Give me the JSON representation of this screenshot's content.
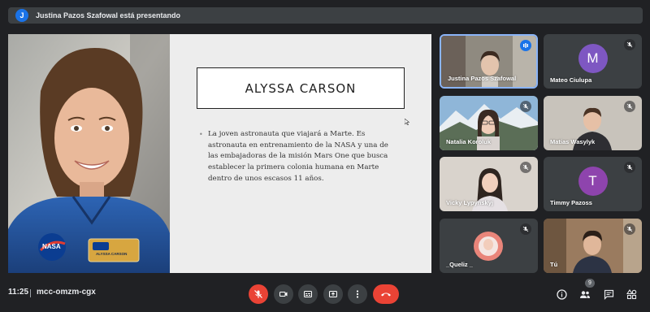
{
  "banner": {
    "avatar_letter": "J",
    "text": "Justina Pazos Szafowal está presentando"
  },
  "slide": {
    "title": "ALYSSA CARSON",
    "body": "La joven astronauta que viajará a Marte. Es astronauta en entrenamiento de la NASA y una de las embajadoras de la misión Mars One que busca establecer la primera colonia humana en Marte dentro de unos escasos 11 años."
  },
  "photo": {
    "patch_text": "NASA",
    "badge_name": "ALYSSA CARSON"
  },
  "participants": [
    {
      "name": "Justina Pazos Szafowal",
      "state": "speaking"
    },
    {
      "name": "Mateo Ciulupa",
      "initial": "M",
      "avatar_color": "#7e57c2",
      "state": "muted"
    },
    {
      "name": "Natalia Koroluk",
      "state": "muted"
    },
    {
      "name": "Matias Wasylyk",
      "state": "muted"
    },
    {
      "name": "Vicky Lypynskyj",
      "state": "muted"
    },
    {
      "name": "Timmy Pazoss",
      "initial": "T",
      "avatar_color": "#8e44ad",
      "state": "muted"
    },
    {
      "name": "_Queliz _",
      "state": "muted"
    },
    {
      "name": "Tú",
      "state": "muted"
    }
  ],
  "bottombar": {
    "time": "11:25",
    "meeting_code": "mcc-omzm-cgx",
    "participant_count": "9",
    "controls": [
      "microphone-muted",
      "camera",
      "captions",
      "present-now",
      "more-options",
      "hang-up"
    ],
    "right_icons": [
      "meeting-details",
      "participants",
      "chat",
      "activities"
    ]
  },
  "colors": {
    "background": "#202124",
    "tile": "#3c4043",
    "danger": "#ea4335",
    "accent": "#8ab4f8",
    "speaking": "#1a73e8"
  }
}
